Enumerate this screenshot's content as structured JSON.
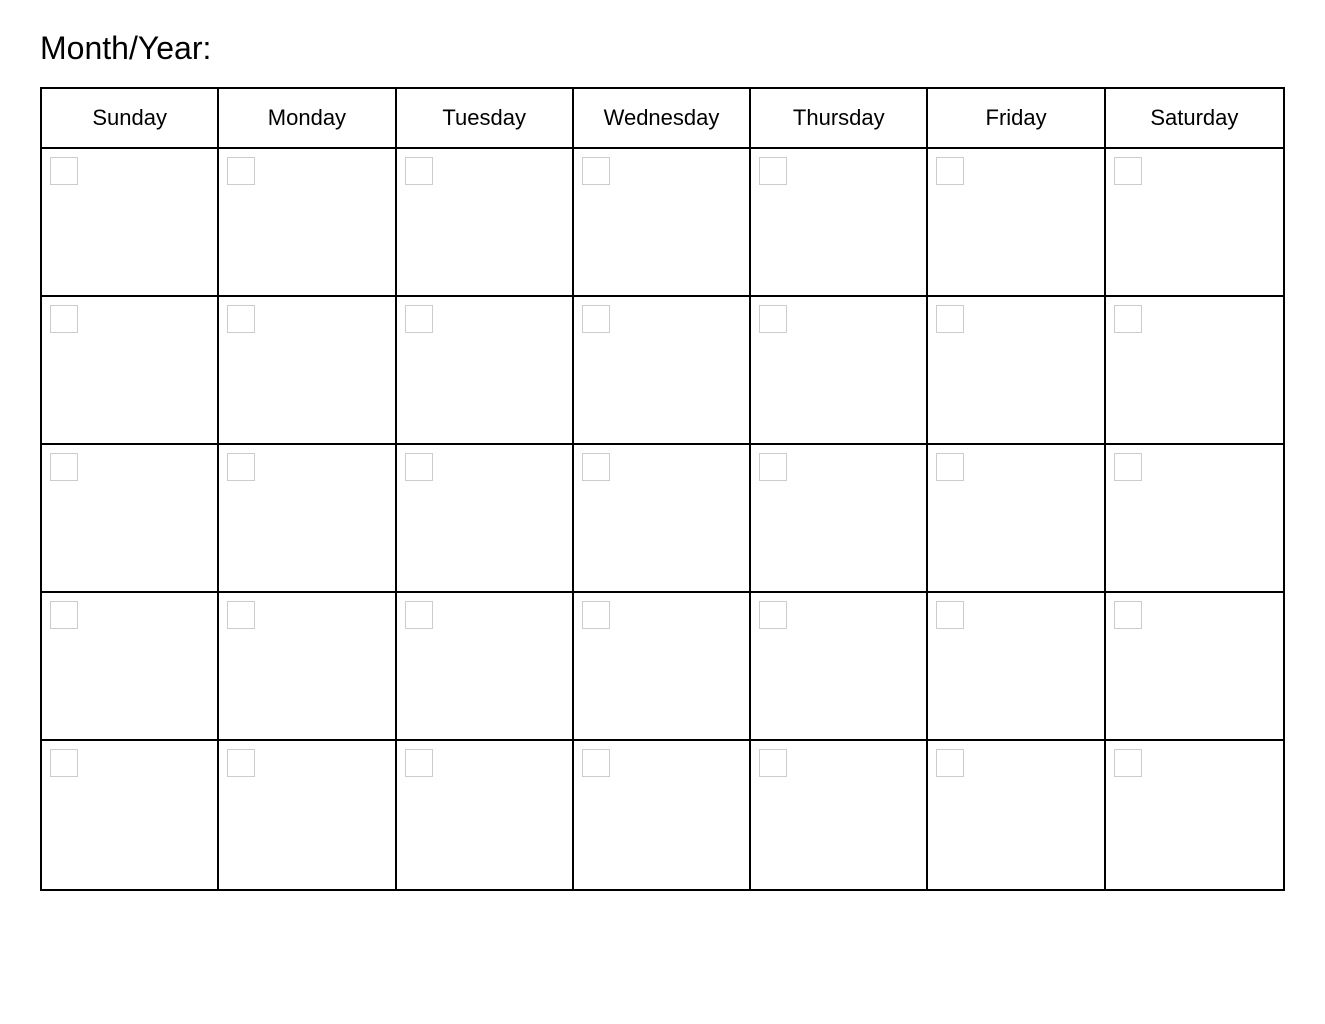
{
  "header": {
    "title": "Month/Year:"
  },
  "calendar": {
    "days": [
      "Sunday",
      "Monday",
      "Tuesday",
      "Wednesday",
      "Thursday",
      "Friday",
      "Saturday"
    ],
    "rows": 5
  }
}
